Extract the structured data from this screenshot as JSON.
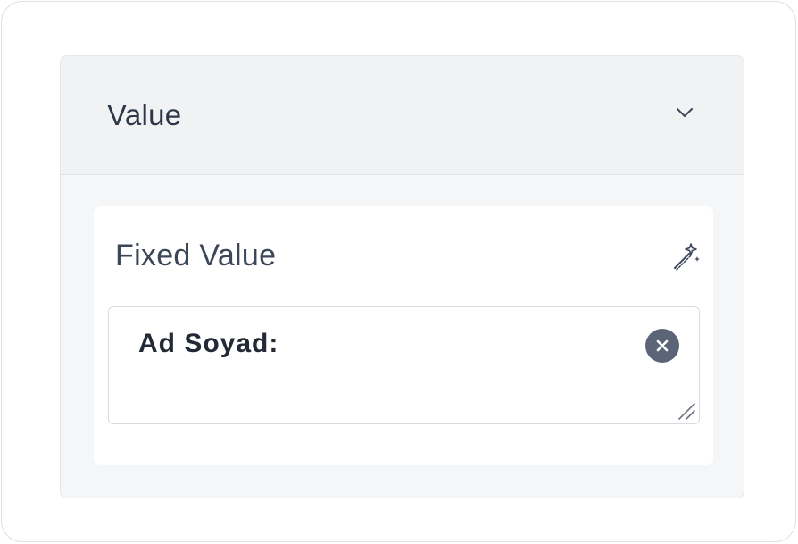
{
  "panel": {
    "title": "Value",
    "expanded": true,
    "toggle_icon": "chevron-down-icon"
  },
  "field": {
    "label": "Fixed Value",
    "action_icon": "magic-wand-icon",
    "value": "Ad Soyad:",
    "clear_icon": "clear-circle-icon",
    "resize_icon": "resize-handle-icon"
  },
  "colors": {
    "header_bg": "#f1f2f4",
    "panel_bg": "#f5f6f8",
    "text_primary": "#2d3748",
    "clear_button": "#5b6577"
  }
}
